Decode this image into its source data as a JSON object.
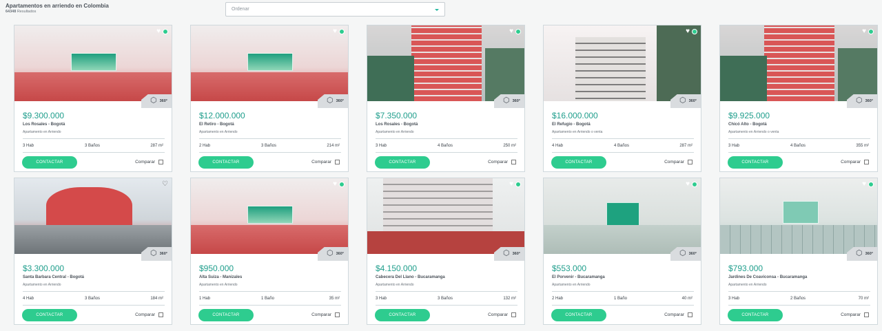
{
  "header": {
    "title": "Apartamentos en arriendo en Colombia",
    "count": "64348",
    "count_suffix": "Resultados"
  },
  "sort": {
    "placeholder": "Ordenar"
  },
  "ui": {
    "contact_label": "CONTACTAR",
    "compare_label": "Comparar",
    "badge_label": "360°"
  },
  "listings": [
    {
      "price": "$9.300.000",
      "location": "Los Rosales - Bogotá",
      "type": "Apartamento en Arriendo",
      "rooms": "3 Hab",
      "baths": "3 Baños",
      "area": "287 m²",
      "scene": "interior"
    },
    {
      "price": "$12.000.000",
      "location": "El Retiro - Bogotá",
      "type": "Apartamento en Arriendo",
      "rooms": "2 Hab",
      "baths": "3 Baños",
      "area": "214 m²",
      "scene": "interior"
    },
    {
      "price": "$7.350.000",
      "location": "Los Rosales - Bogotá",
      "type": "Apartamento en Arriendo",
      "rooms": "3 Hab",
      "baths": "4 Baños",
      "area": "250 m²",
      "scene": "building"
    },
    {
      "price": "$16.000.000",
      "location": "El Refugio - Bogotá",
      "type": "Apartamento en Arriendo o venta",
      "rooms": "4 Hab",
      "baths": "4 Baños",
      "area": "287 m²",
      "scene": "building-grey"
    },
    {
      "price": "$9.925.000",
      "location": "Chicó Alto - Bogotá",
      "type": "Apartamento en Arriendo o venta",
      "rooms": "3 Hab",
      "baths": "4 Baños",
      "area": "355 m²",
      "scene": "building"
    },
    {
      "price": "$3.300.000",
      "location": "Santa Barbara Central - Bogotá",
      "type": "Apartamento en Arriendo",
      "rooms": "4 Hab",
      "baths": "3 Baños",
      "area": "184 m²",
      "scene": "exterior"
    },
    {
      "price": "$950.000",
      "location": "Alta Suiza - Manizales",
      "type": "Apartamento en Arriendo",
      "rooms": "1 Hab",
      "baths": "1 Baño",
      "area": "35 m²",
      "scene": "interior"
    },
    {
      "price": "$4.150.000",
      "location": "Cabecera Del Llano - Bucaramanga",
      "type": "Apartamento en Arriendo",
      "rooms": "3 Hab",
      "baths": "3 Baños",
      "area": "132 m²",
      "scene": "tower"
    },
    {
      "price": "$553.000",
      "location": "El Porvenir - Bucaramanga",
      "type": "Apartamento en Arriendo",
      "rooms": "2 Hab",
      "baths": "1 Baño",
      "area": "40 m²",
      "scene": "empty"
    },
    {
      "price": "$793.000",
      "location": "Jardines De Coaviconsa - Bucaramanga",
      "type": "Apartamento en Arriendo",
      "rooms": "3 Hab",
      "baths": "2 Baños",
      "area": "70 m²",
      "scene": "tiles"
    }
  ]
}
